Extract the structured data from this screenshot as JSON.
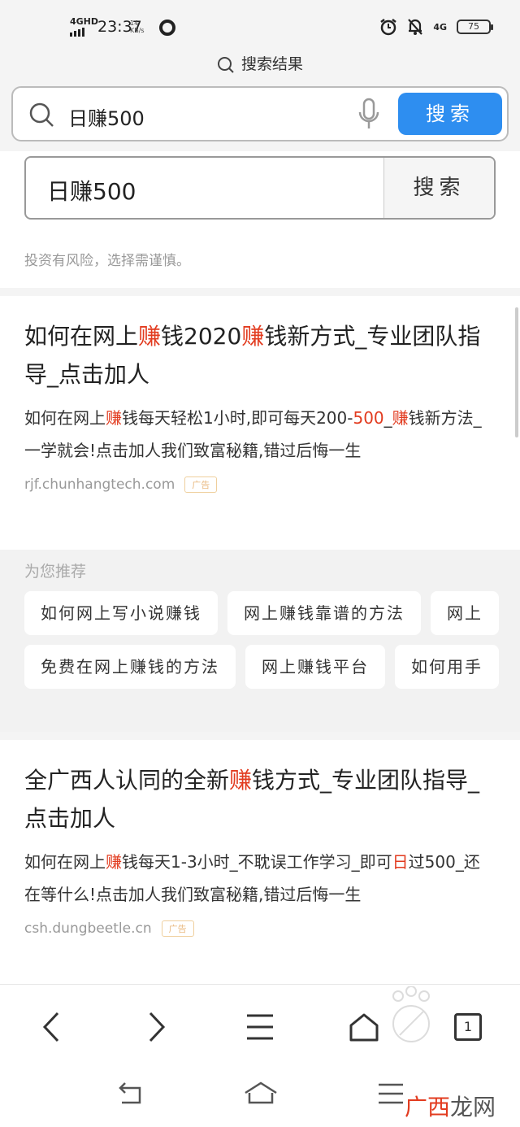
{
  "status_bar": {
    "network": "4GHD",
    "time": "23:37",
    "speed_value": "14",
    "speed_unit": "KB/s",
    "network_right": "4G",
    "battery": "75"
  },
  "header": {
    "title": "搜索结果",
    "search_query": "日赚500",
    "search_button": "搜索"
  },
  "search_box": {
    "value": "日赚500",
    "button": "搜索",
    "risk_notice": "投资有风险，选择需谨慎。"
  },
  "results": [
    {
      "title_parts": [
        "如何在网上",
        "赚",
        "钱2020",
        "赚",
        "钱新方式_专业团队指导_点击加人"
      ],
      "desc_parts": [
        "如何在网上",
        "赚",
        "钱每天轻松1小时,即可每天200-",
        "500",
        "_",
        "赚",
        "钱新方法_一学就会!点击加人我们致富秘籍,错过后悔一生"
      ],
      "source": "rjf.chunhangtech.com",
      "ad_label": "广告"
    },
    {
      "title_parts": [
        "全广西人认同的全新",
        "赚",
        "钱方式_专业团队指导_点击加人"
      ],
      "desc_parts": [
        "如何在网上",
        "赚",
        "钱每天1-3小时_不耽误工作学习_即可",
        "日",
        "过500_还在等什么!点击加人我们致富秘籍,错过后悔一生"
      ],
      "source": "csh.dungbeetle.cn",
      "ad_label": "广告"
    }
  ],
  "recommend": {
    "title": "为您推荐",
    "row1": [
      "如何网上写小说赚钱",
      "网上赚钱靠谱的方法",
      "网上"
    ],
    "row2": [
      "免费在网上赚钱的方法",
      "网上赚钱平台",
      "如何用手"
    ]
  },
  "bottom_nav": {
    "tabs_count": "1"
  },
  "watermark": {
    "red": "广西",
    "dark": "龙网"
  },
  "colors": {
    "accent": "#2e8ef0",
    "highlight": "#e23b1f",
    "ad": "#e9b980"
  }
}
